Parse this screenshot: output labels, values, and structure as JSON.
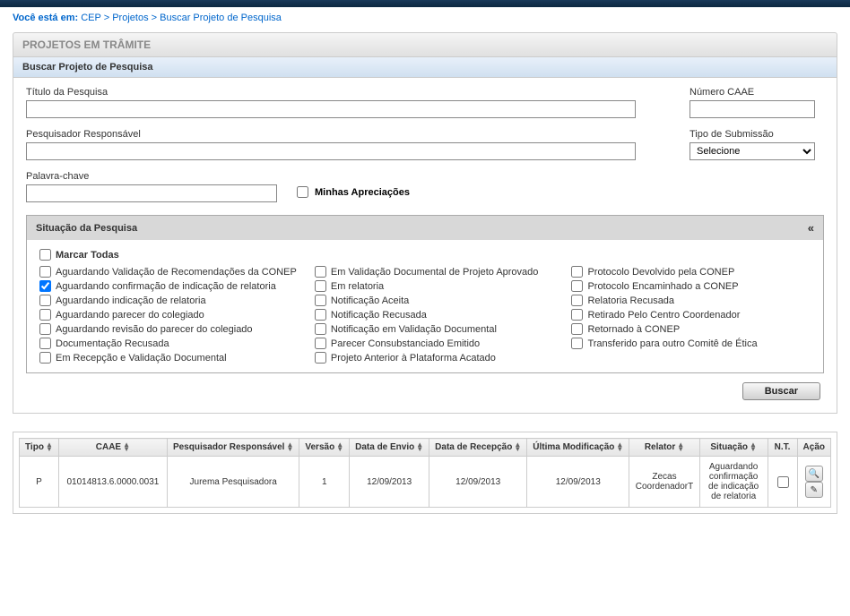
{
  "breadcrumb": {
    "prefix": "Você está em:",
    "parts": [
      "CEP",
      ">",
      "Projetos",
      ">",
      "Buscar Projeto de Pesquisa"
    ]
  },
  "section_title": "PROJETOS EM TRÂMITE",
  "panel": {
    "title": "Buscar Projeto de Pesquisa",
    "fields": {
      "titulo_label": "Título da Pesquisa",
      "caae_label": "Número CAAE",
      "pesquisador_label": "Pesquisador Responsável",
      "tipo_sub_label": "Tipo de Submissão",
      "tipo_sub_value": "Selecione",
      "palavra_label": "Palavra-chave",
      "minhas_label": "Minhas Apreciações"
    },
    "situacao": {
      "title": "Situação da Pesquisa",
      "collapse_glyph": "«",
      "marcar_todas": "Marcar Todas",
      "col1": [
        {
          "label": "Aguardando Validação de Recomendações da CONEP",
          "checked": false
        },
        {
          "label": "Aguardando confirmação de indicação de relatoria",
          "checked": true
        },
        {
          "label": "Aguardando indicação de relatoria",
          "checked": false
        },
        {
          "label": "Aguardando parecer do colegiado",
          "checked": false
        },
        {
          "label": "Aguardando revisão do parecer do colegiado",
          "checked": false
        },
        {
          "label": "Documentação Recusada",
          "checked": false
        },
        {
          "label": "Em Recepção e Validação Documental",
          "checked": false
        }
      ],
      "col2": [
        {
          "label": "Em Validação Documental de Projeto Aprovado",
          "checked": false
        },
        {
          "label": "Em relatoria",
          "checked": false
        },
        {
          "label": "Notificação Aceita",
          "checked": false
        },
        {
          "label": "Notificação Recusada",
          "checked": false
        },
        {
          "label": "Notificação em Validação Documental",
          "checked": false
        },
        {
          "label": "Parecer Consubstanciado Emitido",
          "checked": false
        },
        {
          "label": "Projeto Anterior à Plataforma Acatado",
          "checked": false
        }
      ],
      "col3": [
        {
          "label": "Protocolo Devolvido pela CONEP",
          "checked": false
        },
        {
          "label": "Protocolo Encaminhado a CONEP",
          "checked": false
        },
        {
          "label": "Relatoria Recusada",
          "checked": false
        },
        {
          "label": "Retirado Pelo Centro Coordenador",
          "checked": false
        },
        {
          "label": "Retornado à CONEP",
          "checked": false
        },
        {
          "label": "Transferido para outro Comitê de Ética",
          "checked": false
        }
      ]
    },
    "buscar_label": "Buscar"
  },
  "table": {
    "headers": {
      "tipo": "Tipo",
      "caae": "CAAE",
      "pesquisador": "Pesquisador Responsável",
      "versao": "Versão",
      "envio": "Data de Envio",
      "recepcao": "Data de Recepção",
      "modificacao": "Última Modificação",
      "relator": "Relator",
      "situacao": "Situação",
      "nt": "N.T.",
      "acao": "Ação"
    },
    "rows": [
      {
        "tipo": "P",
        "caae": "01014813.6.0000.0031",
        "pesquisador": "Jurema Pesquisadora",
        "versao": "1",
        "envio": "12/09/2013",
        "recepcao": "12/09/2013",
        "modificacao": "12/09/2013",
        "relator": "Zecas CoordenadorT",
        "situacao": "Aguardando confirmação de indicação de relatoria"
      }
    ]
  }
}
